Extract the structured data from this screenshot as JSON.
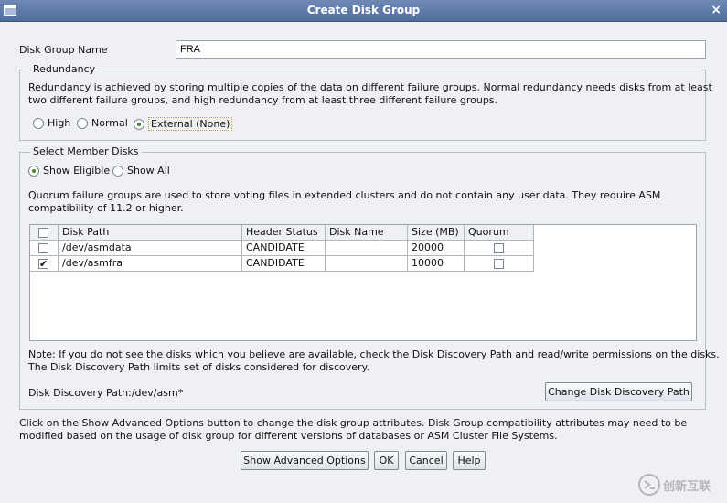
{
  "window": {
    "title": "Create Disk Group",
    "close_glyph": "×"
  },
  "disk_group_name": {
    "label": "Disk Group Name",
    "value": "FRA"
  },
  "redundancy": {
    "legend": "Redundancy",
    "description_line1": "Redundancy is achieved by storing multiple copies of the data on different failure groups. Normal redundancy needs disks from at least",
    "description_line2": "two different failure groups, and high redundancy from at least three different failure groups.",
    "options": [
      {
        "label": "High",
        "selected": false
      },
      {
        "label": "Normal",
        "selected": false
      },
      {
        "label": "External (None)",
        "selected": true
      }
    ]
  },
  "member_disks": {
    "legend": "Select Member Disks",
    "filter_options": [
      {
        "label": "Show Eligible",
        "selected": true
      },
      {
        "label": "Show All",
        "selected": false
      }
    ],
    "quorum_note_line1": "Quorum failure groups are used to store voting files in extended clusters and do not contain any user data. They require ASM",
    "quorum_note_line2": "compatibility of 11.2 or higher.",
    "table": {
      "columns": [
        "Disk Path",
        "Header Status",
        "Disk Name",
        "Size (MB)",
        "Quorum"
      ],
      "rows": [
        {
          "selected": false,
          "disk_path": "/dev/asmdata",
          "header_status": "CANDIDATE",
          "disk_name": "",
          "size_mb": "20000",
          "quorum": false
        },
        {
          "selected": true,
          "disk_path": "/dev/asmfra",
          "header_status": "CANDIDATE",
          "disk_name": "",
          "size_mb": "10000",
          "quorum": false
        }
      ]
    },
    "discovery_note_line1": "Note: If you do not see the disks which you believe are available, check the Disk Discovery Path and read/write permissions on the disks.",
    "discovery_note_line2": "The Disk Discovery Path limits set of disks considered for discovery.",
    "discovery_path_label": "Disk Discovery Path:/dev/asm*",
    "change_path_button": "Change Disk Discovery Path"
  },
  "advanced_note_line1": "Click on the Show Advanced Options button to change the disk group attributes. Disk Group compatibility attributes may need to be",
  "advanced_note_line2": "modified based on the usage of disk group for different versions of databases or ASM Cluster File Systems.",
  "buttons": {
    "advanced": "Show Advanced Options",
    "ok": "OK",
    "cancel": "Cancel",
    "help": "Help"
  },
  "watermark": {
    "text": "创新互联"
  },
  "check_glyph": "✔"
}
